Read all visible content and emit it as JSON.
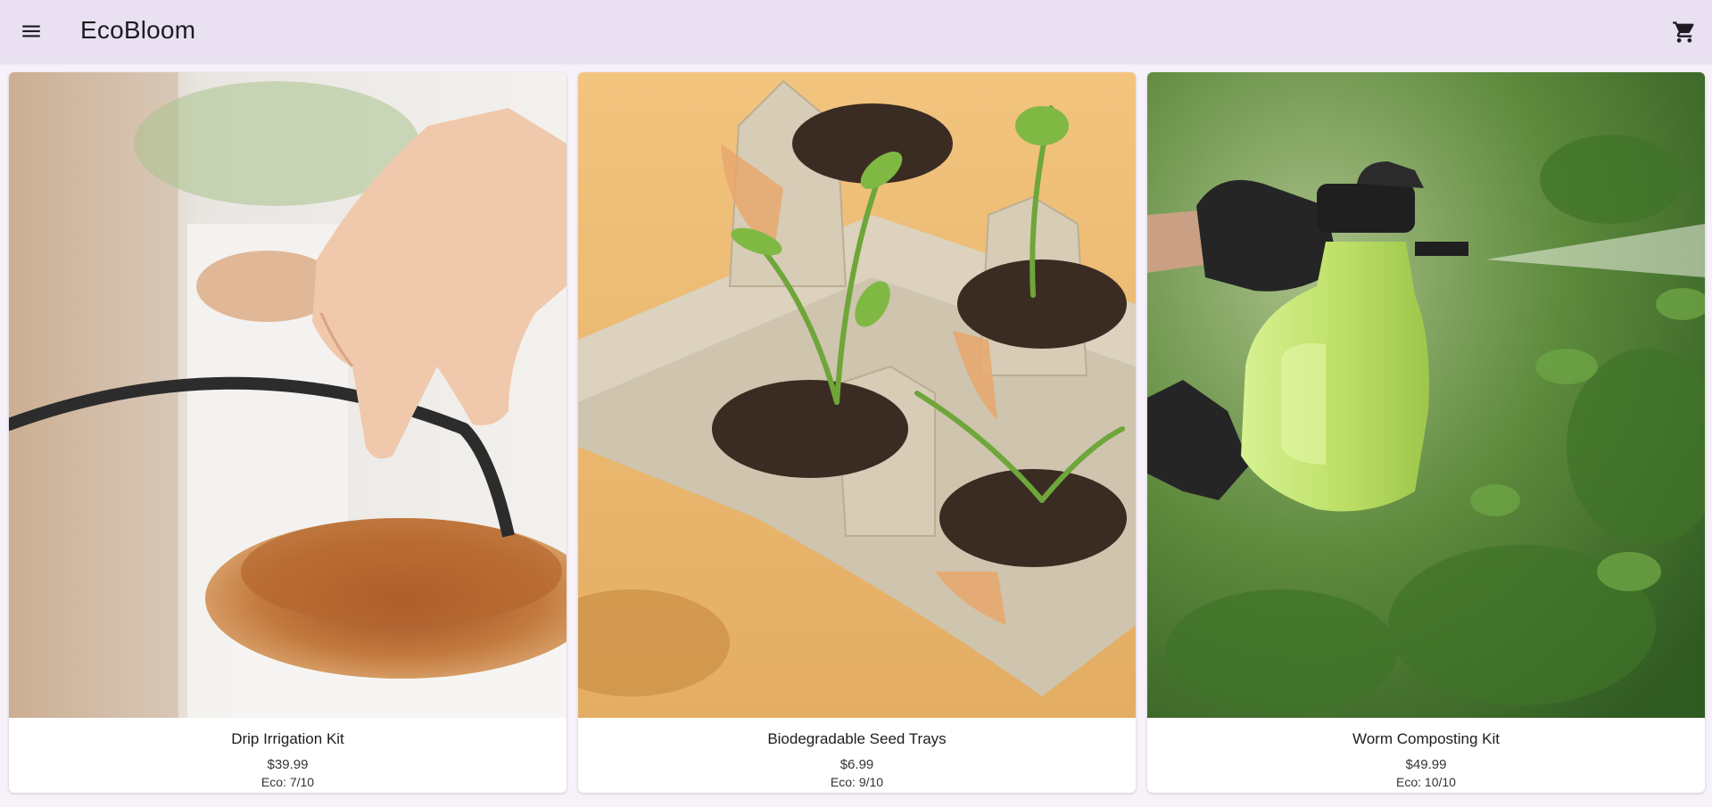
{
  "header": {
    "title": "EcoBloom",
    "menu_icon": "hamburger-menu-icon",
    "cart_icon": "shopping-cart-icon",
    "background": "#e9e0f2"
  },
  "products": [
    {
      "name": "Drip Irrigation Kit",
      "price": "$39.99",
      "eco": "Eco: 7/10"
    },
    {
      "name": "Biodegradable Seed Trays",
      "price": "$6.99",
      "eco": "Eco: 9/10"
    },
    {
      "name": "Worm Composting Kit",
      "price": "$49.99",
      "eco": "Eco: 10/10"
    }
  ]
}
